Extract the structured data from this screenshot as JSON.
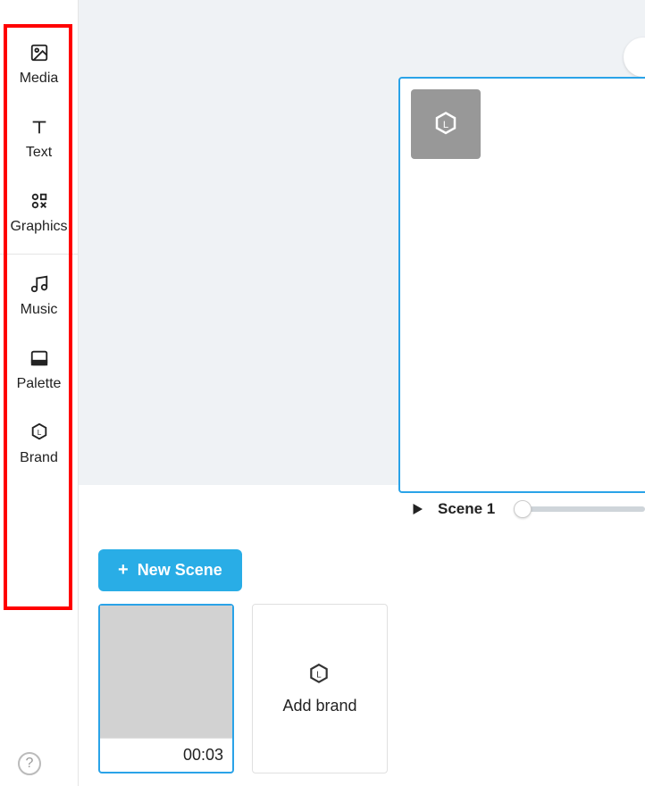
{
  "sidebar": {
    "items": [
      {
        "label": "Media"
      },
      {
        "label": "Text"
      },
      {
        "label": "Graphics"
      },
      {
        "label": "Music"
      },
      {
        "label": "Palette"
      },
      {
        "label": "Brand"
      }
    ]
  },
  "playbar": {
    "scene_label": "Scene 1"
  },
  "buttons": {
    "new_scene": "New Scene"
  },
  "thumbs": {
    "scene1_time": "00:03",
    "add_brand_label": "Add brand"
  }
}
